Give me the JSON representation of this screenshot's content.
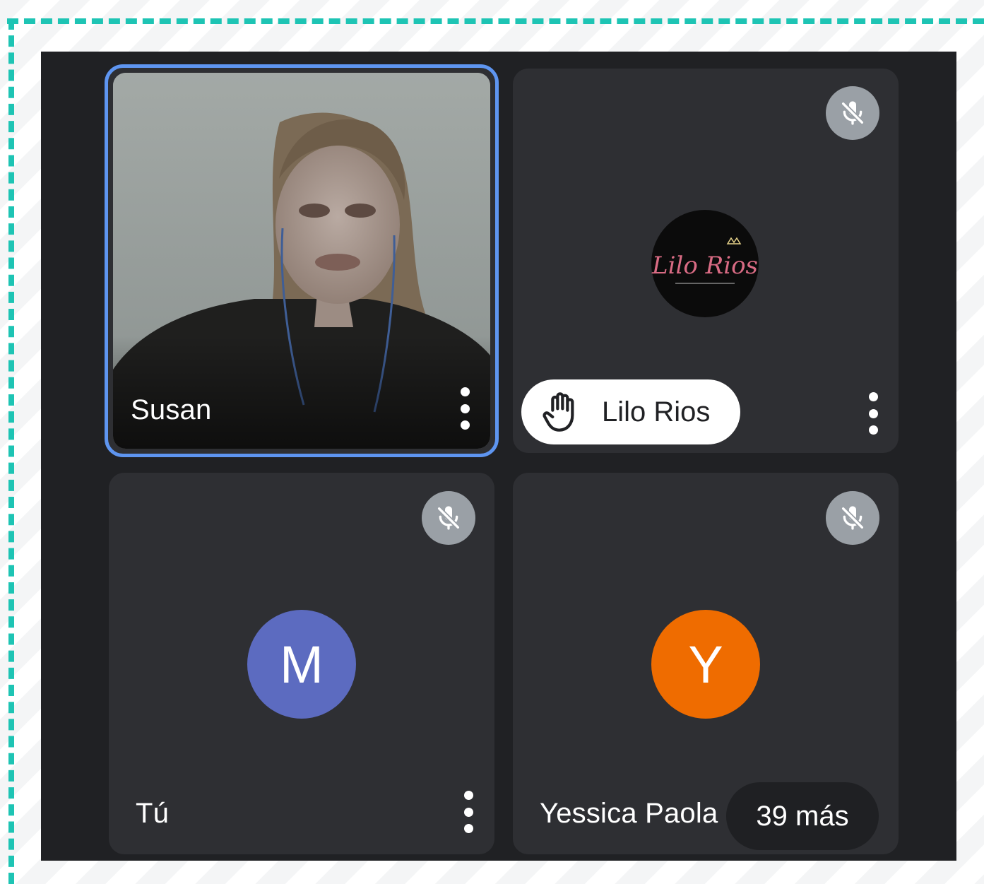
{
  "participants": [
    {
      "name": "Susan",
      "speaking": true
    },
    {
      "name": "Lilo Rios",
      "hand_raised": true,
      "muted": true,
      "avatar_logo_text": "Lilo Rios"
    },
    {
      "name": "Tú",
      "muted": true,
      "avatar_letter": "M",
      "avatar_color": "#5c6bc0"
    },
    {
      "name": "Yessica Paola",
      "muted": true,
      "avatar_letter": "Y",
      "avatar_color": "#ef6c00"
    }
  ],
  "overflow": {
    "label": "39 más"
  },
  "colors": {
    "active_speaker_border": "#5e95f0",
    "frame_dashes": "#1ec4b4",
    "stage_background": "#202124",
    "tile_background": "#2e2f33"
  },
  "icons": {
    "muted": "mic-off-icon",
    "hand": "raised-hand-icon",
    "more": "more-vert-icon"
  }
}
